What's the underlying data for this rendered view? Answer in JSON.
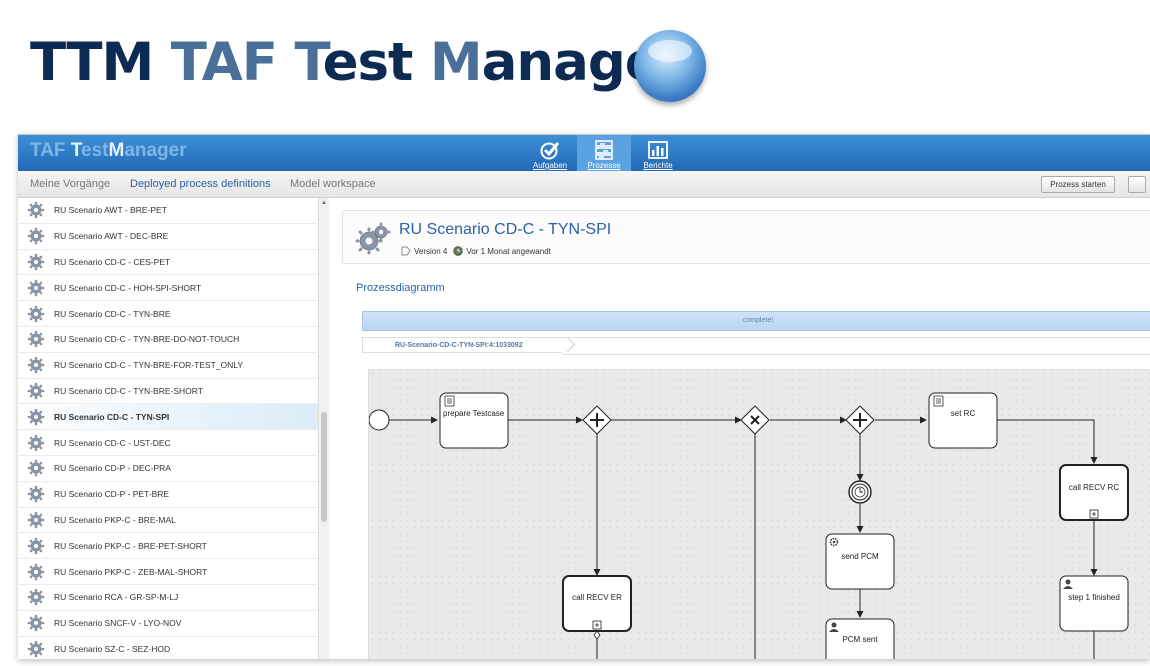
{
  "banner": {
    "title_parts": [
      {
        "text": "TTM ",
        "tone": "dark"
      },
      {
        "text": "TAF ",
        "tone": "light"
      },
      {
        "text": "T",
        "tone": "light"
      },
      {
        "text": "est ",
        "tone": "dark"
      },
      {
        "text": "M",
        "tone": "light"
      },
      {
        "text": "anager",
        "tone": "dark"
      }
    ]
  },
  "app": {
    "brand": {
      "part1": "TAF ",
      "part2": "T",
      "part3": "est",
      "part4": "M",
      "part5": "anager"
    },
    "nav": [
      {
        "label": "Aufgaben",
        "icon": "checkmark-icon",
        "active": false
      },
      {
        "label": "Prozesse",
        "icon": "process-icon",
        "active": true
      },
      {
        "label": "Berichte",
        "icon": "bar-chart-icon",
        "active": false
      }
    ],
    "tabs": [
      "Meine Vorgänge",
      "Deployed process definitions",
      "Model workspace"
    ],
    "active_tab": 1,
    "start_button": "Prozess starten"
  },
  "sidebar": {
    "items": [
      "RU Scenario AWT - BRE-PET",
      "RU Scenario AWT - DEC-BRE",
      "RU Scenario CD-C - CES-PET",
      "RU Scenario CD-C - HOH-SPI-SHORT",
      "RU Scenario CD-C - TYN-BRE",
      "RU Scenario CD-C - TYN-BRE-DO-NOT-TOUCH",
      "RU Scenario CD-C - TYN-BRE-FOR-TEST_ONLY",
      "RU Scenario CD-C - TYN-BRE-SHORT",
      "RU Scenario CD-C - TYN-SPI",
      "RU Scenario CD-C - UST-DEC",
      "RU Scenario CD-P - DEC-PRA",
      "RU Scenario CD-P - PET-BRE",
      "RU Scenario PKP-C - BRE-MAL",
      "RU Scenario PKP-C - BRE-PET-SHORT",
      "RU Scenario PKP-C - ZEB-MAL-SHORT",
      "RU Scenario RCA - GR-SP-M-LJ",
      "RU Scenario SNCF-V - LYO-NOV",
      "RU Scenario SZ-C - SEZ-HOD"
    ],
    "selected_index": 8
  },
  "detail": {
    "title": "RU Scenario CD-C - TYN-SPI",
    "version": "Version 4",
    "deployed": "Vor 1 Monat angewandt",
    "section_title": "Prozessdiagramm",
    "status": "complete!",
    "instance_id": "RU-Scenario-CD-C-TYN-SPI:4:1033092"
  },
  "diagram": {
    "tasks": {
      "prepare": "prepare Testcase",
      "set_rc": "set RC",
      "call_recv_rc": "call RECV RC",
      "call_recv_er": "call RECV ER",
      "send_pcm": "send PCM",
      "pcm_sent": "PCM sent",
      "step1": "step 1 finished"
    }
  },
  "colors": {
    "brand_dark": "#0c2a52",
    "brand_light": "#4a6f98",
    "topbar": "#2a74c0",
    "link_blue": "#2b62a5",
    "progress": "#c4dcf4"
  }
}
